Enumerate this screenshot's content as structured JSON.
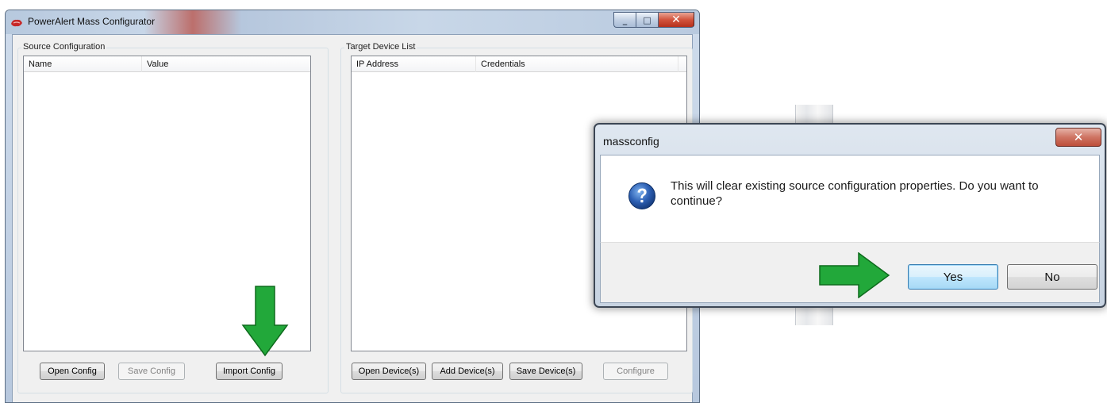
{
  "main_window": {
    "title": "PowerAlert Mass Configurator",
    "controls": {
      "minimize": "_",
      "maximize": "□",
      "close": "✕"
    }
  },
  "source_group": {
    "title": "Source Configuration",
    "columns": [
      "Name",
      "Value"
    ],
    "rows": [],
    "buttons": {
      "open": "Open Config",
      "save": "Save Config",
      "import": "Import Config"
    }
  },
  "target_group": {
    "title": "Target Device List",
    "columns": [
      "IP Address",
      "Credentials"
    ],
    "rows": [],
    "buttons": {
      "open": "Open Device(s)",
      "add": "Add Device(s)",
      "save": "Save Device(s)",
      "configure": "Configure"
    }
  },
  "dialog": {
    "title": "massconfig",
    "close": "✕",
    "message": "This will clear existing source configuration properties. Do you want to continue?",
    "icon": "question-icon",
    "buttons": {
      "yes": "Yes",
      "no": "No"
    }
  },
  "colors": {
    "arrow_green": "#22a83a",
    "arrow_outline": "#0e6b1d",
    "question_blue": "#2c5fb3"
  }
}
